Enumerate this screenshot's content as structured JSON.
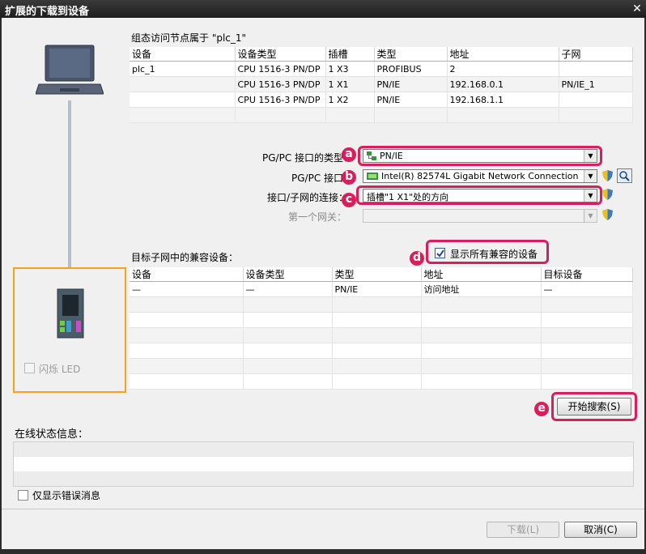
{
  "window": {
    "title": "扩展的下载到设备",
    "close": "✕"
  },
  "config_section": {
    "heading": "组态访问节点属于 \"plc_1\"",
    "columns": [
      "设备",
      "设备类型",
      "插槽",
      "类型",
      "地址",
      "子网"
    ],
    "rows": [
      [
        "plc_1",
        "CPU 1516-3 PN/DP",
        "1 X3",
        "PROFIBUS",
        "2",
        ""
      ],
      [
        "",
        "CPU 1516-3 PN/DP",
        "1 X1",
        "PN/IE",
        "192.168.0.1",
        "PN/IE_1"
      ],
      [
        "",
        "CPU 1516-3 PN/DP",
        "1 X2",
        "PN/IE",
        "192.168.1.1",
        ""
      ],
      [
        "",
        "",
        "",
        "",
        "",
        ""
      ]
    ]
  },
  "connection": {
    "interface_type_label": "PG/PC 接口的类型：",
    "interface_type_value": "PN/IE",
    "interface_label": "PG/PC 接口：",
    "interface_value": "Intel(R) 82574L Gigabit Network Connection",
    "subnet_conn_label": "接口/子网的连接：",
    "subnet_conn_value": "插槽\"1 X1\"处的方向",
    "gateway_label": "第一个网关：",
    "gateway_value": ""
  },
  "badges": {
    "a": "a",
    "b": "b",
    "c": "c",
    "d": "d",
    "e": "e"
  },
  "target_section": {
    "heading": "目标子网中的兼容设备：",
    "show_all_label": "显示所有兼容的设备",
    "show_all_checked": true,
    "columns": [
      "设备",
      "设备类型",
      "类型",
      "地址",
      "目标设备"
    ],
    "rows": [
      [
        "—",
        "—",
        "PN/IE",
        "访问地址",
        "—"
      ],
      [
        "",
        "",
        "",
        "",
        ""
      ],
      [
        "",
        "",
        "",
        "",
        ""
      ],
      [
        "",
        "",
        "",
        "",
        ""
      ],
      [
        "",
        "",
        "",
        "",
        ""
      ],
      [
        "",
        "",
        "",
        "",
        ""
      ],
      [
        "",
        "",
        "",
        "",
        ""
      ]
    ],
    "start_search_label": "开始搜索(S)"
  },
  "flash_led_label": "闪烁 LED",
  "status_section": {
    "heading": "在线状态信息：",
    "error_only_label": "仅显示错误消息"
  },
  "footer": {
    "download_label": "下载(L)",
    "cancel_label": "取消(C)"
  },
  "colors": {
    "highlight": "#d81e5b",
    "device_frame": "#f5a11c",
    "title_bar": "#1e1e1e"
  }
}
